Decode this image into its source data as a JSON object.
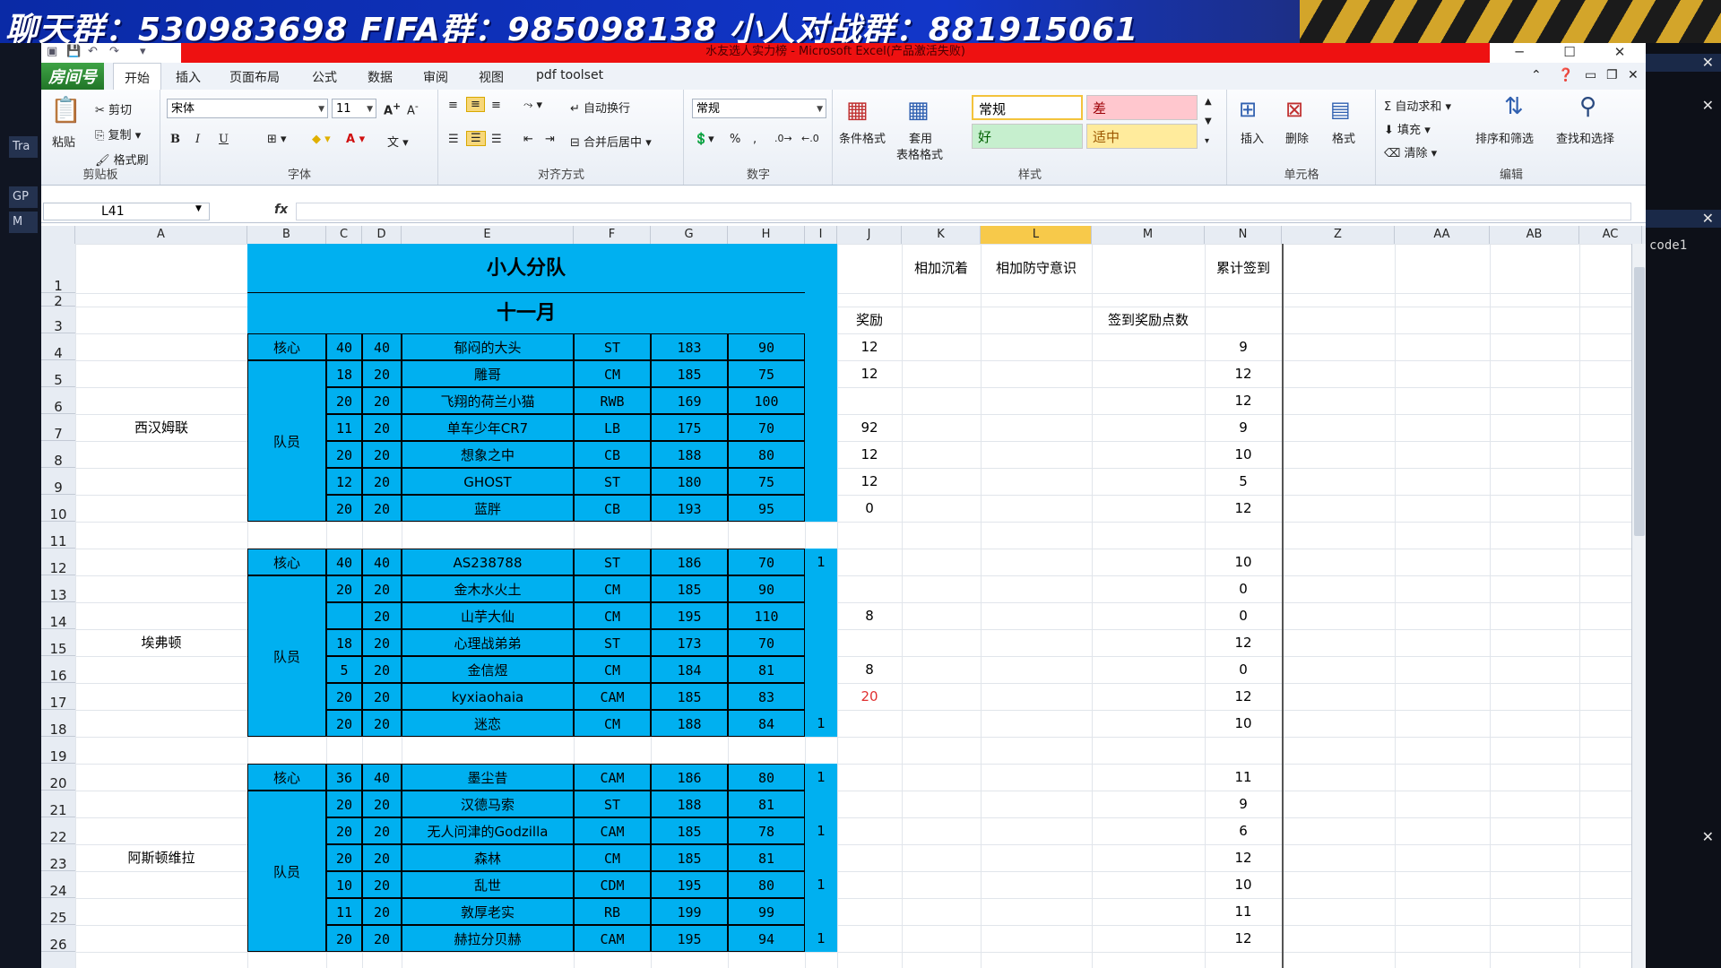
{
  "banner": {
    "text": "聊天群：530983698    FIFA群：985098138    小人对战群：8819150​61"
  },
  "window": {
    "title": "水友选人实力榜 - Microsoft Excel(产品激活失败)",
    "logo": "房间号"
  },
  "tabs": [
    "开始",
    "插入",
    "页面布局",
    "公式",
    "数据",
    "审阅",
    "视图",
    "pdf toolset"
  ],
  "ribbon": {
    "clipboard": {
      "label": "剪贴板",
      "paste": "粘贴",
      "cut": "剪切",
      "copy": "复制",
      "painter": "格式刷"
    },
    "font": {
      "label": "字体",
      "name": "宋体",
      "size": "11",
      "bold": "B",
      "italic": "I",
      "underline": "U"
    },
    "align": {
      "label": "对齐方式",
      "wrap": "自动换行",
      "merge": "合并后居中"
    },
    "number": {
      "label": "数字",
      "format": "常规",
      "percent": "%"
    },
    "styles": {
      "label": "样式",
      "cond": "条件格式",
      "table": "套用",
      "table2": "表格格式",
      "normal": "常规",
      "bad": "差",
      "good": "好",
      "neutral": "适中"
    },
    "cells": {
      "label": "单元格",
      "insert": "插入",
      "delete": "删除",
      "format": "格式"
    },
    "edit": {
      "label": "编辑",
      "autosum": "自动求和",
      "fill": "填充",
      "clear": "清除",
      "sort": "排序和筛选",
      "find": "查找和选择"
    }
  },
  "formula": {
    "namebox": "L41",
    "fx": "fx"
  },
  "columns": [
    "A",
    "B",
    "C",
    "D",
    "E",
    "F",
    "G",
    "H",
    "I",
    "J",
    "K",
    "L",
    "M",
    "N",
    "Z",
    "AA",
    "AB",
    "AC"
  ],
  "rows": [
    "1",
    "2",
    "3",
    "4",
    "5",
    "6",
    "7",
    "8",
    "9",
    "10",
    "11",
    "12",
    "13",
    "14",
    "15",
    "16",
    "17",
    "18",
    "19",
    "20",
    "21",
    "22",
    "23",
    "24",
    "25",
    "26"
  ],
  "sheet": {
    "title": "小人分队",
    "month": "十一月",
    "headers": {
      "J": "奖励",
      "K": "相加沉着",
      "L": "相加防守意识",
      "M": "签到奖励点数",
      "N": "累计签到"
    },
    "core_label": "核心",
    "member_label": "队员",
    "teams": [
      {
        "name": "西汉姆联",
        "rows": [
          [
            "40",
            "40",
            "郁闷的大头",
            "ST",
            "183",
            "90",
            "",
            "12",
            "9"
          ],
          [
            "18",
            "20",
            "雕哥",
            "CM",
            "185",
            "75",
            "",
            "12",
            "12"
          ],
          [
            "20",
            "20",
            "飞翔的荷兰小猫",
            "RWB",
            "169",
            "100",
            "",
            "",
            "12"
          ],
          [
            "11",
            "20",
            "单车少年CR7",
            "LB",
            "175",
            "70",
            "",
            "92",
            "9"
          ],
          [
            "20",
            "20",
            "想象之中",
            "CB",
            "188",
            "80",
            "",
            "12",
            "10"
          ],
          [
            "12",
            "20",
            "GHOST",
            "ST",
            "180",
            "75",
            "",
            "12",
            "5"
          ],
          [
            "20",
            "20",
            "蓝胖",
            "CB",
            "193",
            "95",
            "",
            "0",
            "12"
          ]
        ]
      },
      {
        "name": "埃弗顿",
        "rows": [
          [
            "40",
            "40",
            "AS238788",
            "ST",
            "186",
            "70",
            "1",
            "",
            "10"
          ],
          [
            "20",
            "20",
            "金木水火土",
            "CM",
            "185",
            "90",
            "",
            "",
            "0"
          ],
          [
            "",
            "20",
            "山芋大仙",
            "CM",
            "195",
            "110",
            "",
            "8",
            "0"
          ],
          [
            "18",
            "20",
            "心理战弟弟",
            "ST",
            "173",
            "70",
            "",
            "",
            "12"
          ],
          [
            "5",
            "20",
            "金信煜",
            "CM",
            "184",
            "81",
            "",
            "8",
            "0"
          ],
          [
            "20",
            "20",
            "kyxiaohaia",
            "CAM",
            "185",
            "83",
            "",
            "20",
            "12"
          ],
          [
            "20",
            "20",
            "迷恋",
            "CM",
            "188",
            "84",
            "1",
            "",
            "10"
          ]
        ]
      },
      {
        "name": "阿斯顿维拉",
        "rows": [
          [
            "36",
            "40",
            "墨尘昔",
            "CAM",
            "186",
            "80",
            "1",
            "",
            "11"
          ],
          [
            "20",
            "20",
            "汉德马索",
            "ST",
            "188",
            "81",
            "",
            "",
            "9"
          ],
          [
            "20",
            "20",
            "无人问津的Godzilla",
            "CAM",
            "185",
            "78",
            "1",
            "",
            "6"
          ],
          [
            "20",
            "20",
            "森林",
            "CM",
            "185",
            "81",
            "",
            "",
            "12"
          ],
          [
            "10",
            "20",
            "乱世",
            "CDM",
            "195",
            "80",
            "1",
            "",
            "10"
          ],
          [
            "11",
            "20",
            "敦厚老实",
            "RB",
            "199",
            "99",
            "",
            "",
            "11"
          ],
          [
            "20",
            "20",
            "赫拉分贝赫",
            "CAM",
            "195",
            "94",
            "1",
            "",
            "12"
          ]
        ]
      }
    ]
  },
  "rightpanel": {
    "text": "code1"
  },
  "leftpanel": [
    "Tra",
    "GP",
    "M"
  ]
}
